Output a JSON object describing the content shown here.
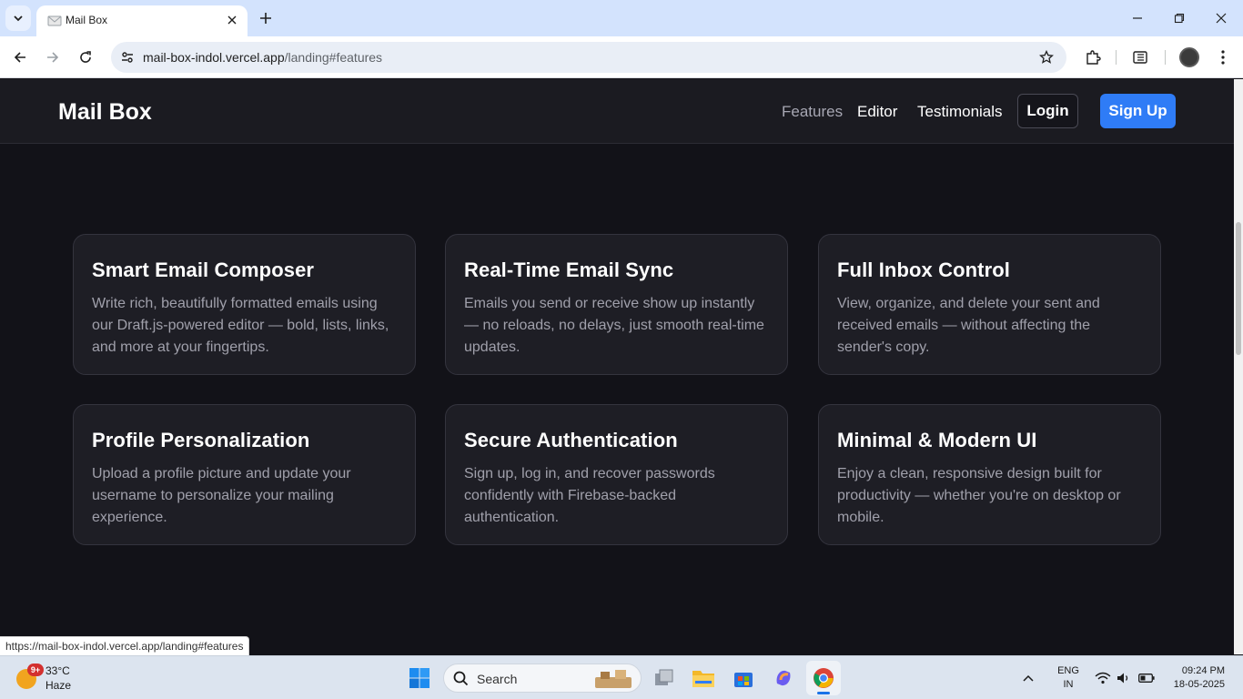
{
  "browser": {
    "tab_title": "Mail Box",
    "url_host": "mail-box-indol.vercel.app",
    "url_path": "/landing#features",
    "status_url": "https://mail-box-indol.vercel.app/landing#features"
  },
  "site": {
    "brand": "Mail Box",
    "nav": {
      "features": "Features",
      "editor": "Editor",
      "testimonials": "Testimonials",
      "login": "Login",
      "signup": "Sign Up"
    },
    "accent": "#2f7cf6"
  },
  "features": [
    {
      "title": "Smart Email Composer",
      "desc": "Write rich, beautifully formatted emails using our Draft.js-powered editor — bold, lists, links, and more at your fingertips."
    },
    {
      "title": "Real-Time Email Sync",
      "desc": "Emails you send or receive show up instantly — no reloads, no delays, just smooth real-time updates."
    },
    {
      "title": "Full Inbox Control",
      "desc": "View, organize, and delete your sent and received emails — without affecting the sender's copy."
    },
    {
      "title": "Profile Personalization",
      "desc": "Upload a profile picture and update your username to personalize your mailing experience."
    },
    {
      "title": "Secure Authentication",
      "desc": "Sign up, log in, and recover passwords confidently with Firebase-backed authentication."
    },
    {
      "title": "Minimal & Modern UI",
      "desc": "Enjoy a clean, responsive design built for productivity — whether you're on desktop or mobile."
    }
  ],
  "taskbar": {
    "weather_badge": "9+",
    "temperature": "33°C",
    "condition": "Haze",
    "search_label": "Search",
    "lang_top": "ENG",
    "lang_bottom": "IN",
    "time": "09:24 PM",
    "date": "18-05-2025"
  }
}
